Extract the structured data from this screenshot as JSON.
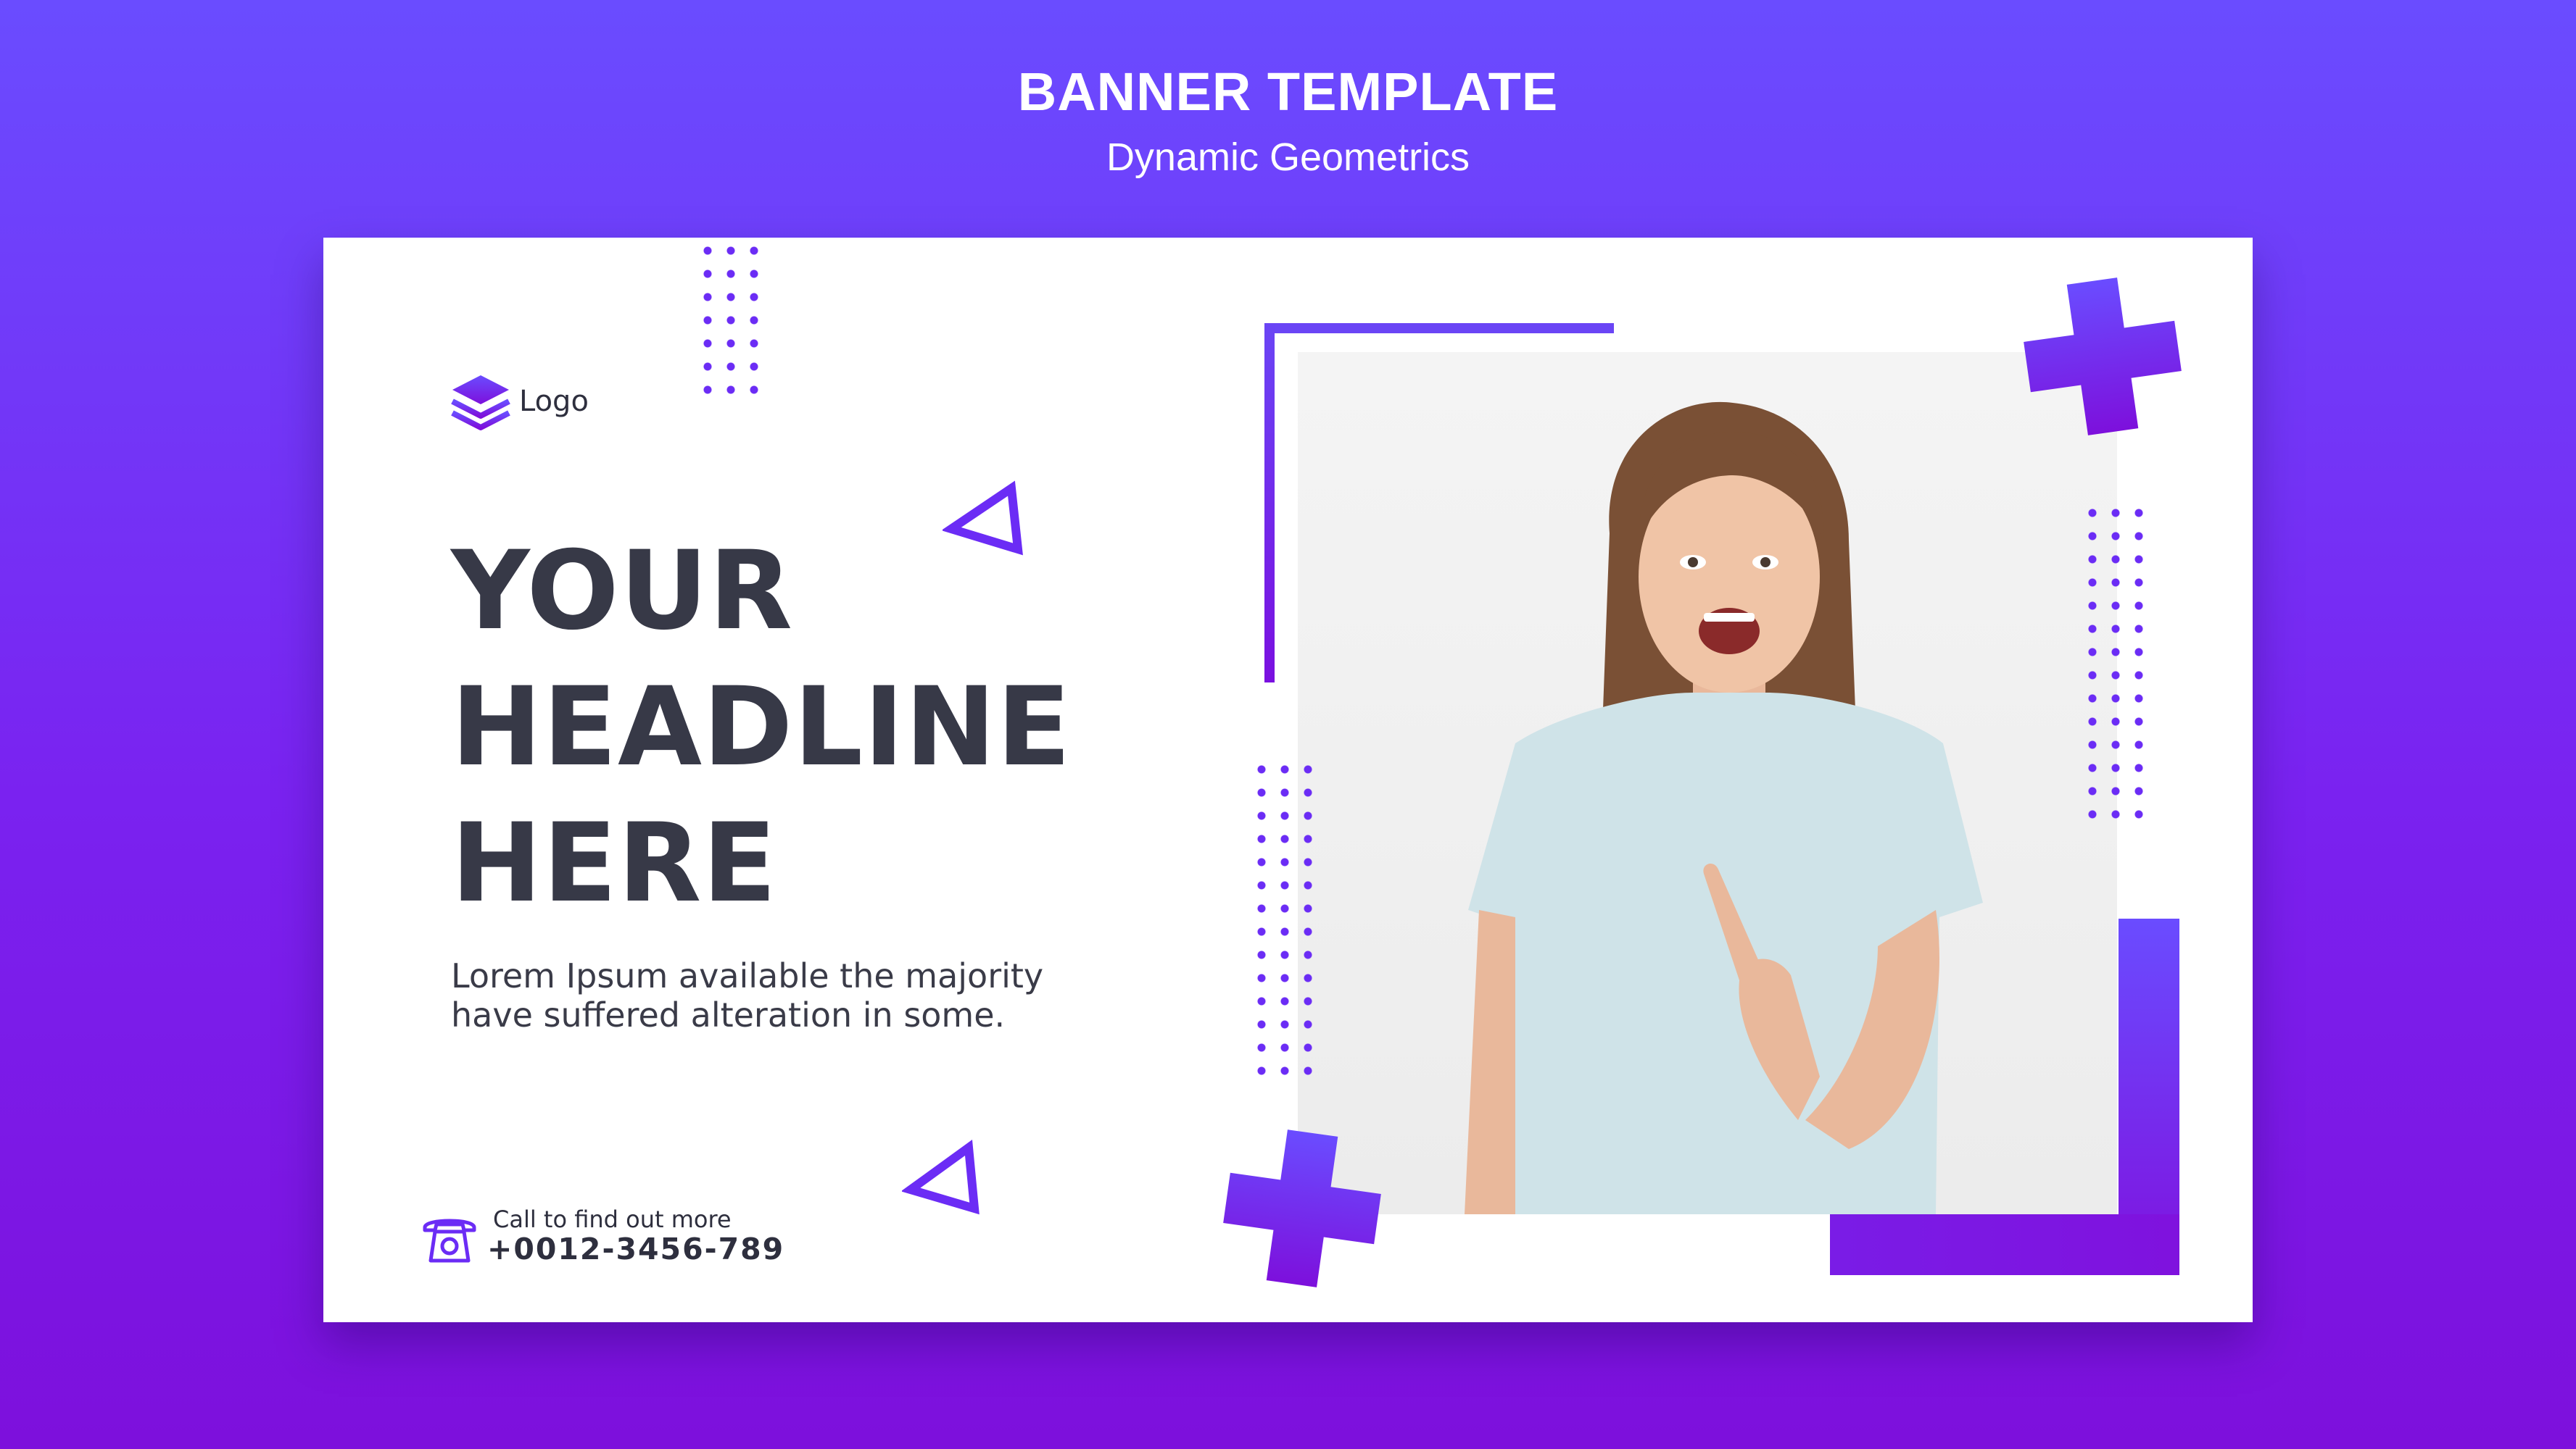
{
  "header": {
    "title": "BANNER TEMPLATE",
    "subtitle": "Dynamic Geometrics"
  },
  "banner": {
    "logo_label": "Logo",
    "headline_lines": [
      "YOUR",
      "HEADLINE",
      "HERE"
    ],
    "body_lines": [
      "Lorem Ipsum available the majority",
      "have suffered alteration in some."
    ],
    "cta_label": "Call to find out more",
    "cta_phone": "+0012-3456-789"
  },
  "colors": {
    "background_top": "#6a4cff",
    "background_bottom": "#7d10dc",
    "accent": "#6b2cf5",
    "headline_text": "#373947",
    "card": "#ffffff"
  },
  "icons": {
    "logo": "layers-icon",
    "cta": "telephone-icon",
    "decorations": [
      "plus-icon",
      "triangle-outline-icon",
      "dot-grid"
    ]
  }
}
